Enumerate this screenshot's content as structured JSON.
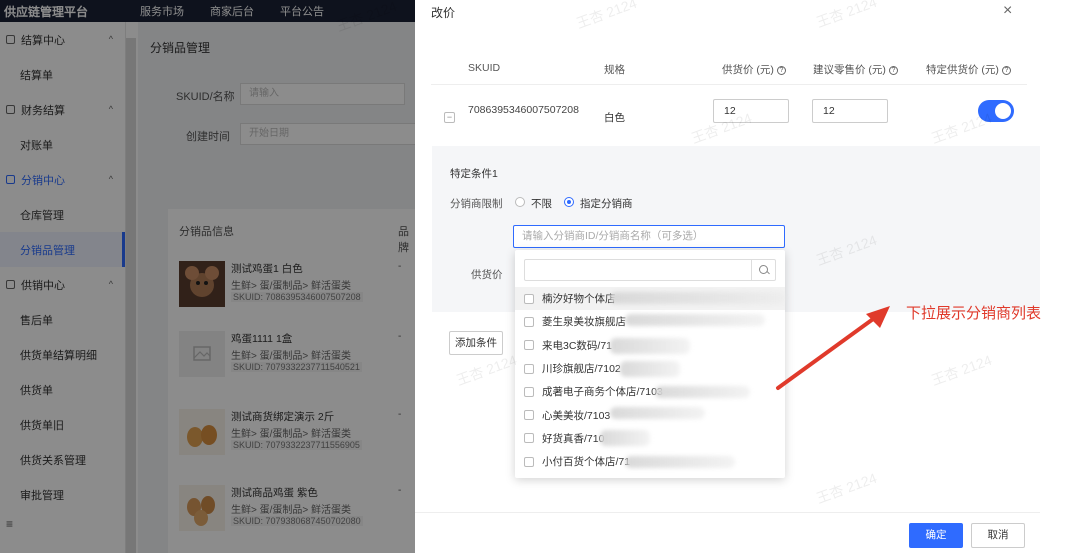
{
  "topbar": {
    "brand": "供应链管理平台",
    "nav": [
      "服务市场",
      "商家后台",
      "平台公告"
    ]
  },
  "sidebar": {
    "items": [
      {
        "type": "group",
        "label": "结算中心",
        "chev": "^"
      },
      {
        "type": "item",
        "label": "结算单"
      },
      {
        "type": "group",
        "label": "财务结算",
        "chev": "^"
      },
      {
        "type": "item",
        "label": "对账单"
      },
      {
        "type": "group",
        "label": "分销中心",
        "chev": "^",
        "active": true
      },
      {
        "type": "item",
        "label": "仓库管理"
      },
      {
        "type": "item",
        "label": "分销品管理",
        "active": true
      },
      {
        "type": "group",
        "label": "供销中心",
        "chev": "^"
      },
      {
        "type": "item",
        "label": "售后单"
      },
      {
        "type": "item",
        "label": "供货单结算明细"
      },
      {
        "type": "item",
        "label": "供货单"
      },
      {
        "type": "item",
        "label": "供货单旧"
      },
      {
        "type": "item",
        "label": "供货关系管理"
      },
      {
        "type": "item",
        "label": "审批管理"
      }
    ],
    "footer_icon": "≡"
  },
  "main": {
    "title": "分销品管理",
    "filters": {
      "sku_label": "SKUID/名称",
      "sku_placeholder": "请输入",
      "created_label": "创建时间",
      "created_placeholder": "开始日期"
    },
    "table": {
      "col_info": "分销品信息",
      "col_other": "品牌",
      "rows": [
        {
          "name": "测试鸡蛋1 白色",
          "category": "生鲜> 蛋/蛋制品> 鲜活蛋类",
          "sku": "SKUID: 7086395346007507208",
          "other": "-"
        },
        {
          "name": "鸡蛋1111 1盒",
          "category": "生鲜> 蛋/蛋制品> 鲜活蛋类",
          "sku": "SKUID: 7079332237711540521",
          "other": "-"
        },
        {
          "name": "测试商货绑定演示 2斤",
          "category": "生鲜> 蛋/蛋制品> 鲜活蛋类",
          "sku": "SKUID: 7079332237711556905",
          "other": "-"
        },
        {
          "name": "测试商品鸡蛋 紫色",
          "category": "生鲜> 蛋/蛋制品> 鲜活蛋类",
          "sku": "SKUID: 7079380687450702080",
          "other": "-"
        }
      ]
    }
  },
  "drawer": {
    "title": "改价",
    "close_icon": "×",
    "columns": {
      "sku": "SKUID",
      "spec": "规格",
      "supply_price": "供货价 (元)",
      "retail_price": "建议零售价 (元)",
      "special_price": "特定供货价 (元)"
    },
    "help_icon": "?",
    "row": {
      "collapse_icon": "−",
      "sku": "7086395346007507208",
      "spec": "白色",
      "supply_price": "12",
      "retail_price": "12",
      "special_enabled": true
    },
    "condition": {
      "title": "特定条件1",
      "limit_label": "分销商限制",
      "option_any": "不限",
      "option_specific": "指定分销商",
      "selected": "指定分销商",
      "input_placeholder": "请输入分销商ID/分销商名称（可多选）",
      "price_label": "供货价"
    },
    "add_condition": "添加条件",
    "dropdown": {
      "search_placeholder": "",
      "items": [
        "楠汐好物个体店",
        "菱生泉美妆旗舰店",
        "来电3C数码/71",
        "川珍旗舰店/7102",
        "成著电子商务个体店/7103",
        "心美美妆/7103",
        "好货真香/710",
        "小付百货个体店/71"
      ]
    },
    "ok": "确定",
    "cancel": "取消"
  },
  "annotation": {
    "text": "下拉展示分销商列表",
    "color": "#e03a2b"
  },
  "watermark": "王杏 2124",
  "colors": {
    "primary": "#2f6bff",
    "topbar": "#1a2236"
  }
}
